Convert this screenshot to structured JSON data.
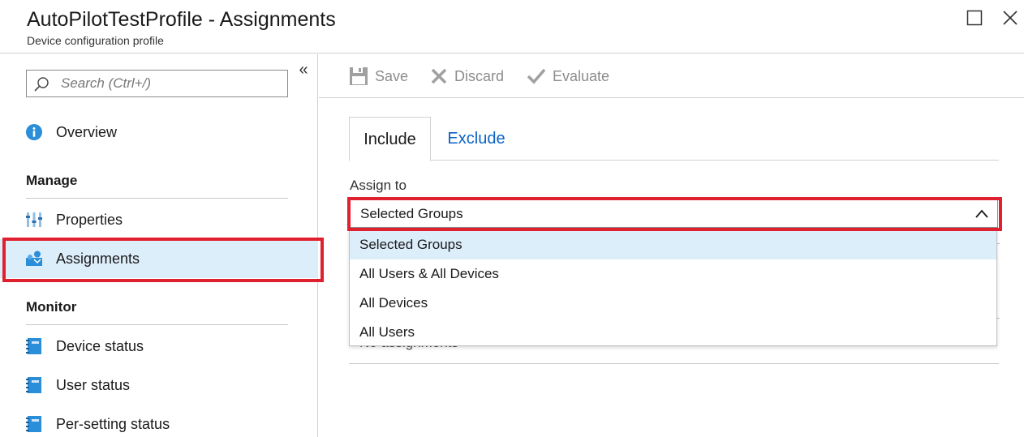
{
  "header": {
    "title": "AutoPilotTestProfile - Assignments",
    "subtitle": "Device configuration profile"
  },
  "sidebar": {
    "collapse_label": "«",
    "search_placeholder": "Search (Ctrl+/)",
    "items": [
      {
        "label": "Overview",
        "icon": "info-icon"
      },
      {
        "label": "Properties",
        "icon": "properties-icon"
      },
      {
        "label": "Assignments",
        "icon": "assignments-icon",
        "active": true
      },
      {
        "label": "Device status",
        "icon": "status-book-icon"
      },
      {
        "label": "User status",
        "icon": "status-book-icon"
      },
      {
        "label": "Per-setting status",
        "icon": "status-book-icon"
      }
    ],
    "sections": {
      "manage": "Manage",
      "monitor": "Monitor"
    }
  },
  "toolbar": {
    "save_label": "Save",
    "discard_label": "Discard",
    "evaluate_label": "Evaluate"
  },
  "tabs": {
    "include": "Include",
    "exclude": "Exclude"
  },
  "assign": {
    "label": "Assign to",
    "selected": "Selected Groups",
    "options": [
      "Selected Groups",
      "All Users & All Devices",
      "All Devices",
      "All Users"
    ],
    "background_text": "No assignments"
  },
  "colors": {
    "accent_blue": "#0b63c4",
    "highlight": "#ddeefb",
    "annotation_red": "#e0202e",
    "icon_blue": "#2b8ed8"
  }
}
